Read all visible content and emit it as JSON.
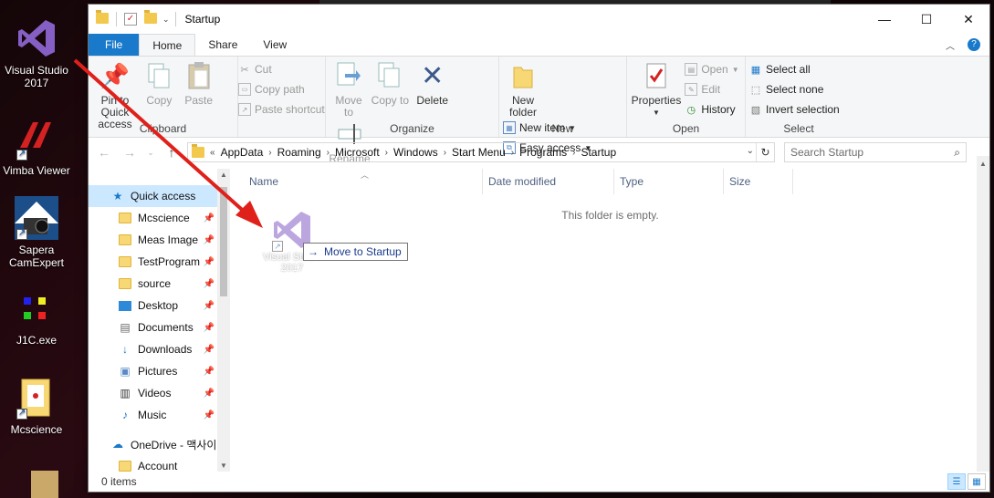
{
  "desktop": {
    "icons": [
      {
        "label": "Visual Studio 2017",
        "icon": "visual-studio-icon"
      },
      {
        "label": "Vimba Viewer",
        "icon": "vimba-viewer-icon"
      },
      {
        "label": "Sapera CamExpert",
        "icon": "sapera-camexpert-icon"
      },
      {
        "label": "J1C.exe",
        "icon": "j1c-exe-icon"
      },
      {
        "label": "Mcscience",
        "icon": "folder-icon"
      }
    ],
    "background_strip_title": "Startup"
  },
  "window": {
    "title": "Startup",
    "controls": {
      "minimize": "—",
      "maximize": "☐",
      "close": "✕"
    }
  },
  "ribbon": {
    "tabs": [
      "File",
      "Home",
      "Share",
      "View"
    ],
    "active_tab": "Home",
    "groups": {
      "clipboard": {
        "label": "Clipboard",
        "pin": "Pin to Quick access",
        "copy": "Copy",
        "paste": "Paste",
        "cut": "Cut",
        "copy_path": "Copy path",
        "paste_shortcut": "Paste shortcut"
      },
      "organize": {
        "label": "Organize",
        "move_to": "Move to",
        "copy_to": "Copy to",
        "delete": "Delete",
        "rename": "Rename"
      },
      "new": {
        "label": "New",
        "new_folder": "New folder",
        "new_item": "New item",
        "easy_access": "Easy access"
      },
      "open": {
        "label": "Open",
        "properties": "Properties",
        "open": "Open",
        "edit": "Edit",
        "history": "History"
      },
      "select": {
        "label": "Select",
        "select_all": "Select all",
        "select_none": "Select none",
        "invert_selection": "Invert selection"
      }
    }
  },
  "address": {
    "prefix": "«",
    "crumbs": [
      "AppData",
      "Roaming",
      "Microsoft",
      "Windows",
      "Start Menu",
      "Programs",
      "Startup"
    ],
    "search_placeholder": "Search Startup"
  },
  "navpane": {
    "quick_access": "Quick access",
    "items": [
      {
        "label": "Mcscience",
        "icon": "folder-icon"
      },
      {
        "label": "Meas Image",
        "icon": "folder-icon"
      },
      {
        "label": "TestProgram",
        "icon": "folder-icon"
      },
      {
        "label": "source",
        "icon": "folder-icon"
      },
      {
        "label": "Desktop",
        "icon": "desktop-icon"
      },
      {
        "label": "Documents",
        "icon": "documents-icon"
      },
      {
        "label": "Downloads",
        "icon": "downloads-icon"
      },
      {
        "label": "Pictures",
        "icon": "pictures-icon"
      },
      {
        "label": "Videos",
        "icon": "videos-icon"
      },
      {
        "label": "Music",
        "icon": "music-icon"
      }
    ],
    "onedrive": "OneDrive - 맥사이",
    "account": "Account"
  },
  "content": {
    "columns": [
      "Name",
      "Date modified",
      "Type",
      "Size"
    ],
    "empty_message": "This folder is empty.",
    "drag": {
      "ghost_label": "Visual Studio 2017",
      "tooltip": "Move to Startup"
    }
  },
  "status": {
    "item_count": "0 items"
  },
  "colors": {
    "file_tab": "#1979ca",
    "selected": "#cce8ff",
    "annotation_arrow": "#e0201b",
    "vs_purple": "#865fc5"
  }
}
